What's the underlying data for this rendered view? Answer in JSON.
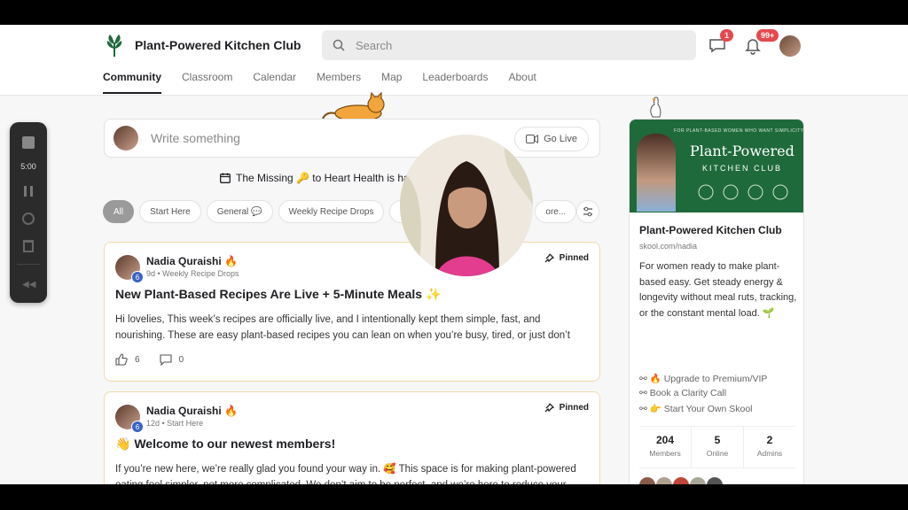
{
  "header": {
    "brand_name": "Plant-Powered Kitchen Club",
    "search_placeholder": "Search",
    "chat_badge": "1",
    "notif_badge": "99+"
  },
  "tabs": [
    "Community",
    "Classroom",
    "Calendar",
    "Members",
    "Map",
    "Leaderboards",
    "About"
  ],
  "recorder": {
    "timer": "5:00"
  },
  "composer": {
    "placeholder": "Write something",
    "go_live": "Go Live"
  },
  "notice": {
    "text": "The Missing 🔑 to Heart Health is ha"
  },
  "chips": [
    "All",
    "Start Here",
    "General 💬",
    "Weekly Recipe Drops",
    "Me",
    "ore..."
  ],
  "posts": [
    {
      "author": "Nadia Quraishi 🔥",
      "level": "6",
      "meta": "9d • Weekly Recipe Drops",
      "pinned": "Pinned",
      "title": "New Plant-Based Recipes Are Live + 5-Minute Meals ✨",
      "body": "Hi lovelies, This week’s recipes are officially live, and I intentionally kept them simple, fast, and nourishing. These are easy plant-based recipes you can lean on when you’re busy, tired, or just don’t",
      "likes": "6",
      "comments": "0"
    },
    {
      "author": "Nadia Quraishi 🔥",
      "level": "6",
      "meta": "12d • Start Here",
      "pinned": "Pinned",
      "title": "👋 Welcome to our newest members!",
      "body": "If you’re new here, we’re really glad you found your way in. 🥰 This space is for making plant-powered eating feel simpler, not more complicated. We don’t aim to be perfect, and we’re here to reduce your"
    }
  ],
  "sidebar": {
    "banner_tag": "FOR PLANT-BASED WOMEN WHO WANT SIMPLICITY",
    "banner_title": "Plant-Powered",
    "banner_subtitle": "KITCHEN CLUB",
    "name": "Plant-Powered Kitchen Club",
    "url": "skool.com/nadia",
    "description": "For women ready to make plant-based easy. Get steady energy & longevity without meal ruts, tracking, or the constant mental load. 🌱",
    "links": [
      "🔥 Upgrade to Premium/VIP",
      "Book a Clarity Call",
      "👉 Start Your Own Skool"
    ],
    "stats": [
      {
        "value": "204",
        "label": "Members"
      },
      {
        "value": "5",
        "label": "Online"
      },
      {
        "value": "2",
        "label": "Admins"
      }
    ]
  }
}
